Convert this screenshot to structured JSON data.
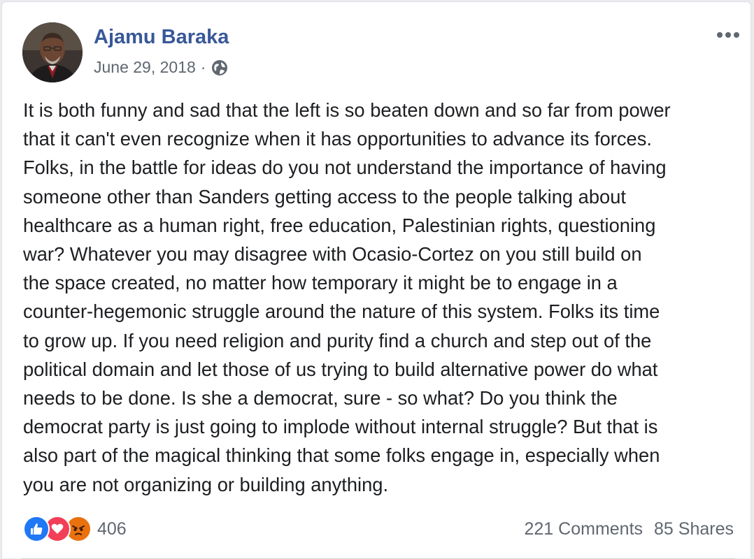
{
  "post": {
    "author": "Ajamu Baraka",
    "date": "June 29, 2018",
    "separator": "·",
    "privacy_icon": "globe-icon",
    "text": "It is both funny and sad that the left is so beaten down and so far from power\nthat it can't even recognize when it has opportunities to advance its forces.\nFolks, in the battle for ideas do you not understand the importance of having\nsomeone other than Sanders getting access to the people talking about\nhealthcare as a human right, free education, Palestinian rights, questioning\nwar? Whatever you may disagree with Ocasio-Cortez on you still build on\nthe space created, no matter how temporary it might be to engage in a\ncounter-hegemonic struggle around the nature of this system. Folks its time\nto grow up. If you need religion and purity find a church and step out of the\npolitical domain and let those of us trying to build alternative power do what\nneeds to be done. Is she a democrat, sure - so what? Do you think the\ndemocrat party is just going to implode without internal struggle? But that is\nalso part of the magical thinking that some folks engage in, especially when\nyou are not organizing or building anything."
  },
  "reactions": {
    "icons": [
      "like-icon",
      "love-icon",
      "angry-icon"
    ],
    "count": "406"
  },
  "stats": {
    "comments": "221 Comments",
    "shares": "85 Shares"
  },
  "colors": {
    "author": "#385898",
    "meta": "#606770",
    "text": "#1c1e21",
    "like": "#2078f4",
    "love": "#f33e58",
    "angry": "#e9710f"
  }
}
